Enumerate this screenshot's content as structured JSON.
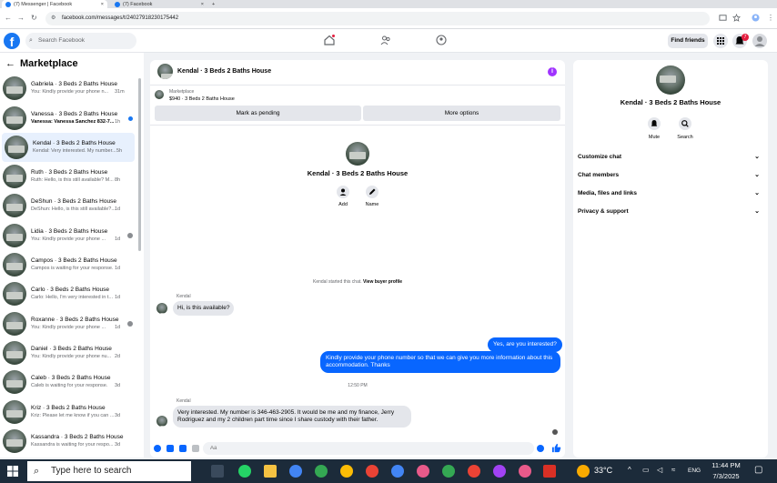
{
  "browser": {
    "tabs": [
      {
        "label": "(7) Messenger | Facebook"
      },
      {
        "label": "(7) Facebook"
      }
    ],
    "new_tab": "+",
    "url": "facebook.com/messages/t/24027918230175442"
  },
  "header": {
    "search_placeholder": "Search Facebook",
    "find_friends": "Find friends",
    "notification_count": "7",
    "logo": "f"
  },
  "sidebar": {
    "title": "Marketplace",
    "chats": [
      {
        "name": "Gabriela · 3 Beds 2 Baths House",
        "preview": "You: Kindly provide your phone n...",
        "time": "31m"
      },
      {
        "name": "Vanessa · 3 Beds 2 Baths House",
        "preview": "Vanessa: Vanessa Sanchez 832-7...",
        "time": "1h",
        "unread": true
      },
      {
        "name": "Kendal · 3 Beds 2 Baths House",
        "preview": "Kendal: Very interested. My number...",
        "time": "5h",
        "selected": true
      },
      {
        "name": "Ruth · 3 Beds 2 Baths House",
        "preview": "Ruth: Hello, is this still available? M...",
        "time": "8h"
      },
      {
        "name": "DeShun · 3 Beds 2 Baths House",
        "preview": "DeShun: Hello, is this still available?...",
        "time": "1d"
      },
      {
        "name": "Lidia · 3 Beds 2 Baths House",
        "preview": "You: Kindly provide your phone ...",
        "time": "1d",
        "seen": true
      },
      {
        "name": "Campos · 3 Beds 2 Baths House",
        "preview": "Campos is waiting for your response.",
        "time": "1d"
      },
      {
        "name": "Carlo · 3 Beds 2 Baths House",
        "preview": "Carlo: Hello, I'm very interested in t...",
        "time": "1d"
      },
      {
        "name": "Roxanne · 3 Beds 2 Baths House",
        "preview": "You: Kindly provide your phone ...",
        "time": "1d",
        "seen": true
      },
      {
        "name": "Daniel · 3 Beds 2 Baths House",
        "preview": "You: Kindly provide your phone nu...",
        "time": "2d"
      },
      {
        "name": "Caleb · 3 Beds 2 Baths House",
        "preview": "Caleb is waiting for your response.",
        "time": "3d"
      },
      {
        "name": "Kriz · 3 Beds 2 Baths House",
        "preview": "Kriz: Please let me know if you can ...",
        "time": "3d"
      },
      {
        "name": "Kassandra · 3 Beds 2 Baths House",
        "preview": "Kassandra is waiting for your respo...",
        "time": "3d"
      }
    ]
  },
  "chat": {
    "title": "Kendal · 3 Beds 2 Baths House",
    "marketplace_label": "Marketplace",
    "listing": "$940 · 3 Beds 2 Baths House",
    "mark_pending": "Mark as pending",
    "more_options": "More options",
    "profile_name": "Kendal · 3 Beds 2 Baths House",
    "add_label": "Add",
    "name_label": "Name",
    "started_text": "Kendal started this chat.",
    "view_profile": "View buyer profile",
    "sender": "Kendal",
    "sender2": "Kendal",
    "msg1": "Hi, is this available?",
    "reply1": "Yes, are you interested?",
    "reply2": "Kindly provide your phone number so that we can give you more information about this accommodation. Thanks",
    "timestamp": "12:50 PM",
    "msg2": "Very interested. My number is 346-463-2905. It would be me and my finance, Jerry Rodriguez and my 2 children part time since I share custody with their father.",
    "input_placeholder": "Aa"
  },
  "right_panel": {
    "name": "Kendal · 3 Beds 2 Baths House",
    "mute": "Mute",
    "search": "Search",
    "rows": [
      "Customize chat",
      "Chat members",
      "Media, files and links",
      "Privacy & support"
    ]
  },
  "taskbar": {
    "search_placeholder": "Type here to search",
    "temperature": "33°C",
    "language": "ENG",
    "time": "11:44 PM",
    "date": "7/3/2025"
  },
  "colors": {
    "brand": "#1877f2",
    "outgoing_bubble": "#0866ff",
    "incoming_bubble": "#e4e6eb"
  }
}
